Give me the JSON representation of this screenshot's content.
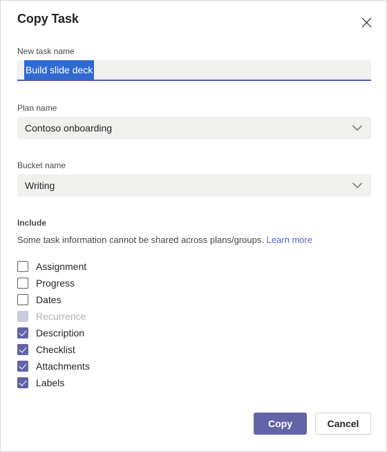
{
  "dialog": {
    "title": "Copy Task",
    "close_icon": "close-icon"
  },
  "new_task_name": {
    "label": "New task name",
    "value": "Build slide deck",
    "placeholder": "Enter task name",
    "selected": true
  },
  "plan_name": {
    "label": "Plan name",
    "value": "Contoso onboarding",
    "chevron_icon": "chevron-down-icon"
  },
  "bucket_name": {
    "label": "Bucket name",
    "value": "Writing",
    "chevron_icon": "chevron-down-icon"
  },
  "include": {
    "title": "Include",
    "description": "Some task information cannot be shared across plans/groups.",
    "learn_more_label": "Learn more",
    "options": [
      {
        "label": "Assignment",
        "checked": false,
        "disabled": false
      },
      {
        "label": "Progress",
        "checked": false,
        "disabled": false
      },
      {
        "label": "Dates",
        "checked": false,
        "disabled": false
      },
      {
        "label": "Recurrence",
        "checked": false,
        "disabled": true
      },
      {
        "label": "Description",
        "checked": true,
        "disabled": false
      },
      {
        "label": "Checklist",
        "checked": true,
        "disabled": false
      },
      {
        "label": "Attachments",
        "checked": true,
        "disabled": false
      },
      {
        "label": "Labels",
        "checked": true,
        "disabled": false
      }
    ]
  },
  "footer": {
    "copy_label": "Copy",
    "cancel_label": "Cancel"
  },
  "colors": {
    "accent_purple": "#6264a7",
    "underline_purple": "#5558af",
    "link_purple": "#5b5fc7",
    "selection_blue": "#2f6ad1",
    "field_background": "#f0f0ef",
    "disabled_checkbox": "#c9ccdf",
    "dialog_border": "#d6d6d6"
  }
}
